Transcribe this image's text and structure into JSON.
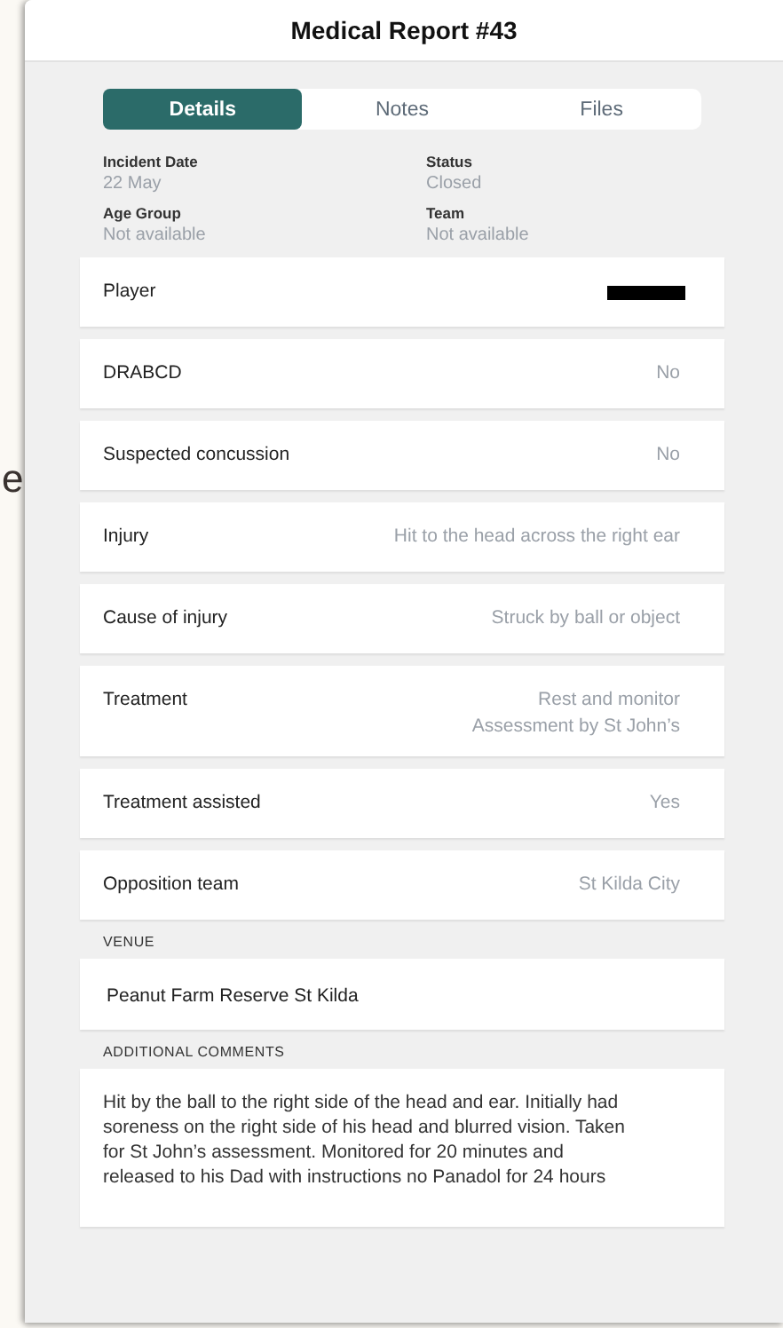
{
  "background_text": "e",
  "window": {
    "title": "Medical Report #43"
  },
  "tabs": [
    {
      "label": "Details",
      "selected": true
    },
    {
      "label": "Notes",
      "selected": false
    },
    {
      "label": "Files",
      "selected": false
    }
  ],
  "summary": [
    {
      "label": "Incident Date",
      "value": "22 May"
    },
    {
      "label": "Status",
      "value": "Closed"
    },
    {
      "label": "Age Group",
      "value": "Not available"
    },
    {
      "label": "Team",
      "value": "Not available"
    }
  ],
  "fields": [
    {
      "label": "Player",
      "redacted": true
    },
    {
      "label": "DRABCD",
      "value": "No"
    },
    {
      "label": "Suspected concussion",
      "value": "No"
    },
    {
      "label": "Injury",
      "value": "Hit to the head across the right ear"
    },
    {
      "label": "Cause of injury",
      "value": "Struck by ball or object"
    },
    {
      "label": "Treatment",
      "value": "Rest and monitor\nAssessment by St John’s"
    },
    {
      "label": "Treatment assisted",
      "value": "Yes"
    },
    {
      "label": "Opposition team",
      "value": "St Kilda City"
    }
  ],
  "venue": {
    "heading": "VENUE",
    "value": "Peanut Farm Reserve St Kilda"
  },
  "comments": {
    "heading": "ADDITIONAL COMMENTS",
    "value": "Hit by the ball to the right side of the head and ear. Initially had\nsoreness on the right side of his head and blurred vision. Taken\nfor St John’s assessment. Monitored for 20 minutes and\nreleased to his Dad with instructions no Panadol for 24 hours"
  }
}
